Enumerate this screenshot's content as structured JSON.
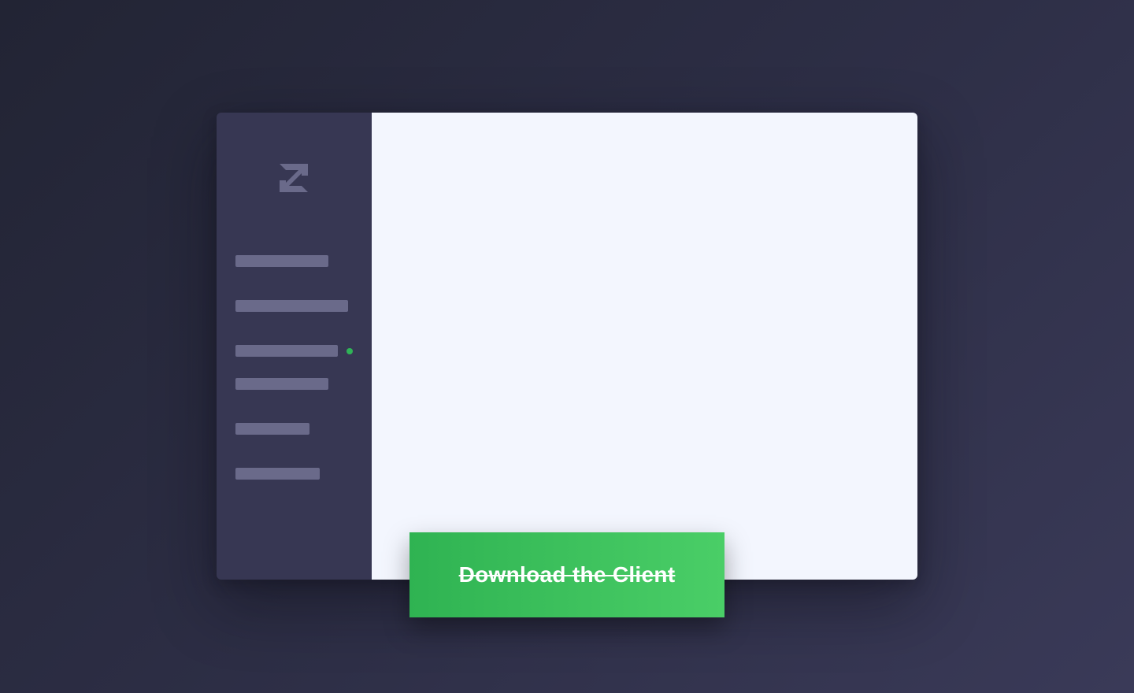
{
  "colors": {
    "background_start": "#222434",
    "background_end": "#3a3a58",
    "sidebar": "#373753",
    "sidebar_placeholder": "#6a6a8a",
    "content": "#f3f6fe",
    "status_dot": "#2fb457",
    "button_start": "#2fb352",
    "button_end": "#4ace67"
  },
  "sidebar": {
    "logo_icon": "z-logo-icon",
    "items": [
      {
        "name": "nav-placeholder-1"
      },
      {
        "name": "nav-placeholder-2"
      },
      {
        "name": "nav-placeholder-3",
        "active": true
      },
      {
        "name": "nav-placeholder-4"
      },
      {
        "name": "nav-placeholder-5"
      },
      {
        "name": "nav-placeholder-6"
      }
    ]
  },
  "cta": {
    "label": "Download the Client"
  }
}
